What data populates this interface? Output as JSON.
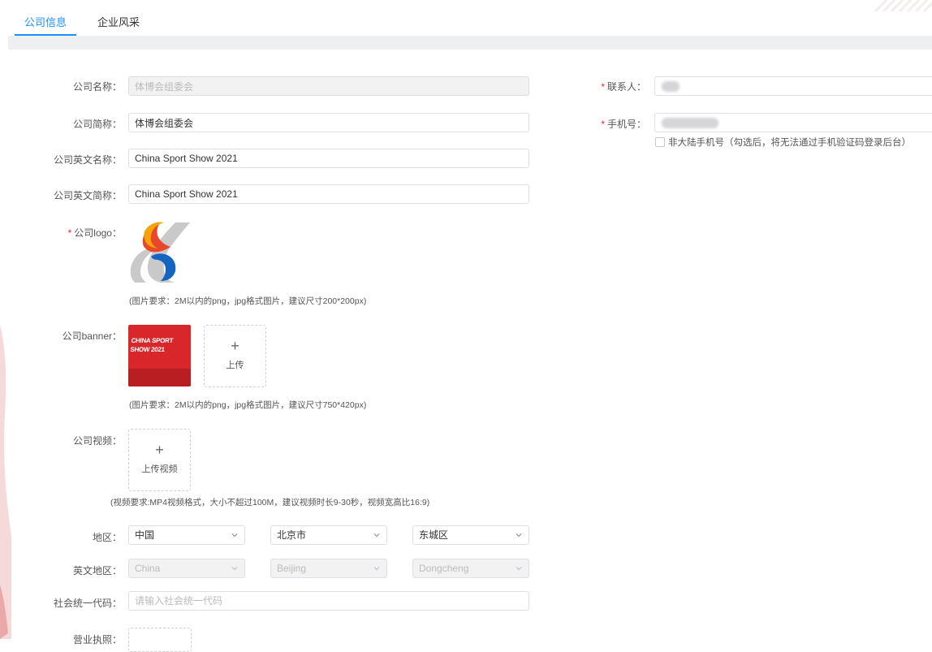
{
  "tabs": [
    {
      "label": "公司信息",
      "active": true
    },
    {
      "label": "企业风采",
      "active": false
    }
  ],
  "colors": {
    "accent": "#1890ff",
    "required": "#f5222d"
  },
  "form": {
    "company_name": {
      "label": "公司名称：",
      "value": "体博会组委会",
      "disabled": true
    },
    "company_short": {
      "label": "公司简称：",
      "value": "体博会组委会"
    },
    "company_en_name": {
      "label": "公司英文名称：",
      "value": "China Sport Show 2021"
    },
    "company_en_short": {
      "label": "公司英文简称：",
      "value": "China Sport Show 2021"
    },
    "logo": {
      "label": "公司logo：",
      "required": true,
      "hint": "(图片要求：2M以内的png，jpg格式图片，建议尺寸200*200px)"
    },
    "banner": {
      "label": "公司banner：",
      "upload_label": "上传",
      "image_text": "CHINA SPORT SHOW 2021",
      "hint": "(图片要求：2M以内的png，jpg格式图片，建议尺寸750*420px)"
    },
    "video": {
      "label": "公司视频：",
      "upload_label": "上传视频",
      "hint": "(视频要求:MP4视频格式，大小不超过100M，建议视频时长9-30秒，视频宽高比16:9)"
    },
    "region": {
      "label": "地区：",
      "country": "中国",
      "city": "北京市",
      "district": "东城区"
    },
    "en_region": {
      "label": "英文地区：",
      "country": "China",
      "city": "Beijing",
      "district": "Dongcheng",
      "disabled": true
    },
    "credit_code": {
      "label": "社会统一代码：",
      "placeholder": "请输入社会统一代码",
      "value": ""
    },
    "license": {
      "label": "营业执照："
    },
    "contact": {
      "label": "联系人：",
      "required": true
    },
    "phone": {
      "label": "手机号：",
      "required": true
    },
    "non_mainland": {
      "label": "非大陆手机号（勾选后，将无法通过手机验证码登录后台）",
      "checked": false
    }
  }
}
